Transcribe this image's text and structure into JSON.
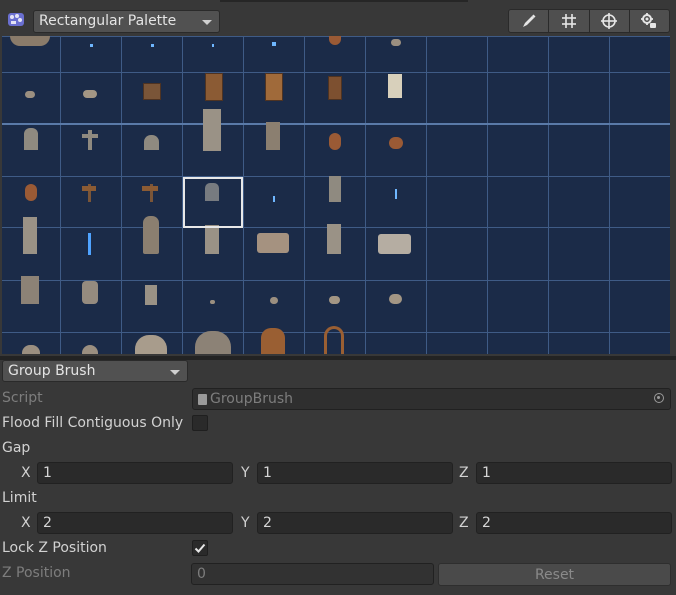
{
  "toolbar": {
    "palette_label": "Rectangular Palette",
    "tools": [
      {
        "icon": "paint-brush-icon"
      },
      {
        "icon": "grid-icon"
      },
      {
        "icon": "gizmo-icon"
      },
      {
        "icon": "palette-settings-icon"
      }
    ]
  },
  "inspector": {
    "brush_label": "Group Brush",
    "script_label": "Script",
    "script_value": "GroupBrush",
    "flood_label": "Flood Fill Contiguous Only",
    "flood_checked": false,
    "gap_label": "Gap",
    "gap": {
      "x_label": "X",
      "x": "1",
      "y_label": "Y",
      "y": "1",
      "z_label": "Z",
      "z": "1"
    },
    "limit_label": "Limit",
    "limit": {
      "x_label": "X",
      "x": "2",
      "y_label": "Y",
      "y": "2",
      "z_label": "Z",
      "z": "2"
    },
    "lock_z_label": "Lock Z Position",
    "lock_z_checked": true,
    "z_position_label": "Z Position",
    "z_position_value": "0",
    "reset_label": "Reset"
  }
}
